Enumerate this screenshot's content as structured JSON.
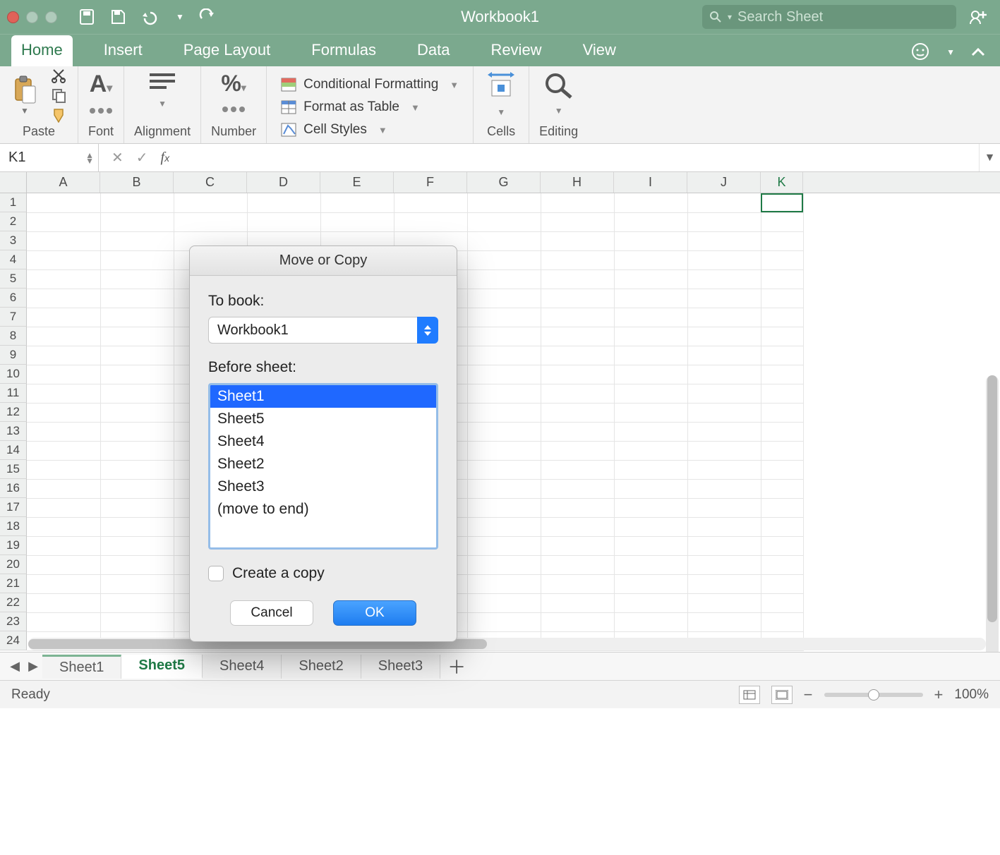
{
  "titlebar": {
    "app_title": "Workbook1",
    "search_placeholder": "Search Sheet"
  },
  "ribbon_tabs": [
    "Home",
    "Insert",
    "Page Layout",
    "Formulas",
    "Data",
    "Review",
    "View"
  ],
  "active_tab": "Home",
  "ribbon_groups": {
    "paste": "Paste",
    "font": "Font",
    "alignment": "Alignment",
    "number": "Number",
    "styles": {
      "cond": "Conditional Formatting",
      "table": "Format as Table",
      "cellstyles": "Cell Styles"
    },
    "cells": "Cells",
    "editing": "Editing"
  },
  "namebox": "K1",
  "columns": [
    "A",
    "B",
    "C",
    "D",
    "E",
    "F",
    "G",
    "H",
    "I",
    "J",
    "K"
  ],
  "active_column_index": 10,
  "rows": 24,
  "sheet_tabs": [
    "Sheet1",
    "Sheet5",
    "Sheet4",
    "Sheet2",
    "Sheet3"
  ],
  "active_sheet": "Sheet5",
  "status": {
    "ready": "Ready",
    "zoom": "100%"
  },
  "dialog": {
    "title": "Move or Copy",
    "to_book_label": "To book:",
    "to_book_value": "Workbook1",
    "before_label": "Before sheet:",
    "options": [
      "Sheet1",
      "Sheet5",
      "Sheet4",
      "Sheet2",
      "Sheet3",
      "(move to end)"
    ],
    "selected_option_index": 0,
    "copy_label": "Create a copy",
    "cancel": "Cancel",
    "ok": "OK"
  }
}
